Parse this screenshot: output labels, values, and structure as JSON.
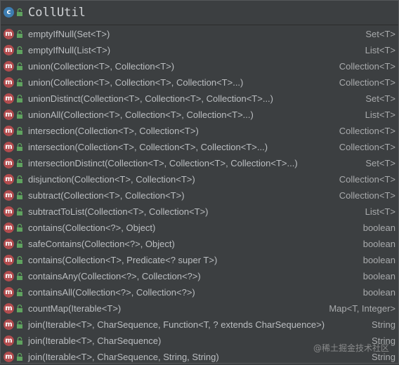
{
  "header": {
    "class_icon_letter": "c",
    "title": "CollUtil"
  },
  "method_icon_letter": "m",
  "colors": {
    "background": "#3c3f41",
    "method_icon": "#b24c4e",
    "class_icon": "#3d7db1",
    "lock": "#5fa35f",
    "text": "#bbbec1"
  },
  "methods": [
    {
      "signature": "emptyIfNull(Set<T>)",
      "return_type": "Set<T>"
    },
    {
      "signature": "emptyIfNull(List<T>)",
      "return_type": "List<T>"
    },
    {
      "signature": "union(Collection<T>, Collection<T>)",
      "return_type": "Collection<T>"
    },
    {
      "signature": "union(Collection<T>, Collection<T>, Collection<T>...)",
      "return_type": "Collection<T>"
    },
    {
      "signature": "unionDistinct(Collection<T>, Collection<T>, Collection<T>...)",
      "return_type": "Set<T>"
    },
    {
      "signature": "unionAll(Collection<T>, Collection<T>, Collection<T>...)",
      "return_type": "List<T>"
    },
    {
      "signature": "intersection(Collection<T>, Collection<T>)",
      "return_type": "Collection<T>"
    },
    {
      "signature": "intersection(Collection<T>, Collection<T>, Collection<T>...)",
      "return_type": "Collection<T>"
    },
    {
      "signature": "intersectionDistinct(Collection<T>, Collection<T>, Collection<T>...)",
      "return_type": "Set<T>"
    },
    {
      "signature": "disjunction(Collection<T>, Collection<T>)",
      "return_type": "Collection<T>"
    },
    {
      "signature": "subtract(Collection<T>, Collection<T>)",
      "return_type": "Collection<T>"
    },
    {
      "signature": "subtractToList(Collection<T>, Collection<T>)",
      "return_type": "List<T>"
    },
    {
      "signature": "contains(Collection<?>, Object)",
      "return_type": "boolean"
    },
    {
      "signature": "safeContains(Collection<?>, Object)",
      "return_type": "boolean"
    },
    {
      "signature": "contains(Collection<T>, Predicate<? super T>)",
      "return_type": "boolean"
    },
    {
      "signature": "containsAny(Collection<?>, Collection<?>)",
      "return_type": "boolean"
    },
    {
      "signature": "containsAll(Collection<?>, Collection<?>)",
      "return_type": "boolean"
    },
    {
      "signature": "countMap(Iterable<T>)",
      "return_type": "Map<T, Integer>"
    },
    {
      "signature": "join(Iterable<T>, CharSequence, Function<T, ? extends CharSequence>)",
      "return_type": "String"
    },
    {
      "signature": "join(Iterable<T>, CharSequence)",
      "return_type": "String"
    },
    {
      "signature": "join(Iterable<T>, CharSequence, String, String)",
      "return_type": "String"
    }
  ],
  "watermark": "@稀土掘金技术社区"
}
